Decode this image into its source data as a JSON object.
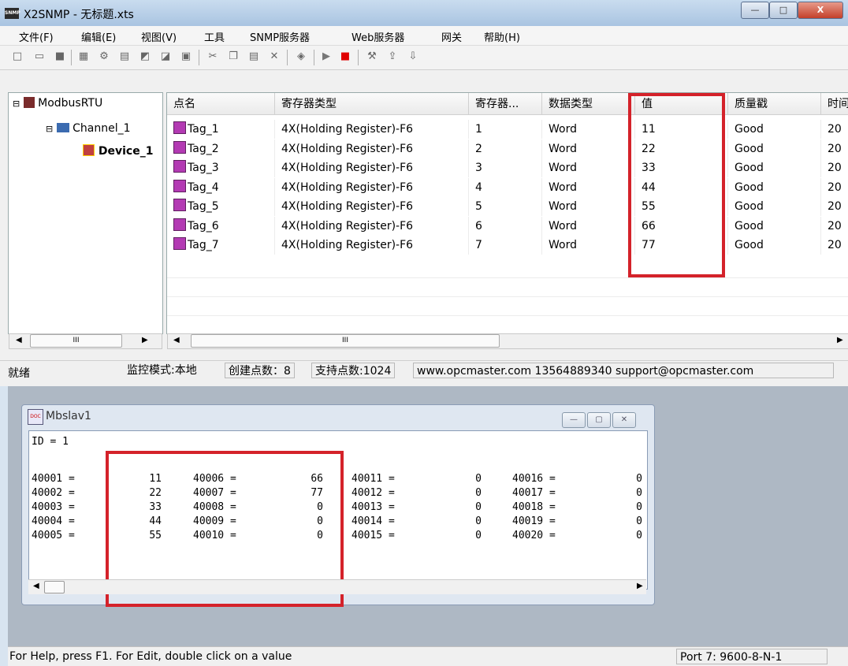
{
  "window": {
    "title": "X2SNMP - 无标题.xts",
    "app_icon": "SNMP",
    "min_glyph": "—",
    "max_glyph": "□",
    "close_glyph": "X"
  },
  "menu": [
    "文件(F)",
    "编辑(E)",
    "视图(V)",
    "工具",
    "SNMP服务器",
    "Web服务器",
    "网关",
    "帮助(H)"
  ],
  "tree": {
    "root": "ModbusRTU",
    "channel": "Channel_1",
    "device": "Device_1"
  },
  "grid": {
    "headers": [
      "点名",
      "寄存器类型",
      "寄存器...",
      "数据类型",
      "值",
      "质量戳",
      "时间"
    ],
    "rows": [
      {
        "name": "Tag_1",
        "reg_type": "4X(Holding Register)-F6",
        "addr": "1",
        "dtype": "Word",
        "value": "11",
        "quality": "Good",
        "time": "20"
      },
      {
        "name": "Tag_2",
        "reg_type": "4X(Holding Register)-F6",
        "addr": "2",
        "dtype": "Word",
        "value": "22",
        "quality": "Good",
        "time": "20"
      },
      {
        "name": "Tag_3",
        "reg_type": "4X(Holding Register)-F6",
        "addr": "3",
        "dtype": "Word",
        "value": "33",
        "quality": "Good",
        "time": "20"
      },
      {
        "name": "Tag_4",
        "reg_type": "4X(Holding Register)-F6",
        "addr": "4",
        "dtype": "Word",
        "value": "44",
        "quality": "Good",
        "time": "20"
      },
      {
        "name": "Tag_5",
        "reg_type": "4X(Holding Register)-F6",
        "addr": "5",
        "dtype": "Word",
        "value": "55",
        "quality": "Good",
        "time": "20"
      },
      {
        "name": "Tag_6",
        "reg_type": "4X(Holding Register)-F6",
        "addr": "6",
        "dtype": "Word",
        "value": "66",
        "quality": "Good",
        "time": "20"
      },
      {
        "name": "Tag_7",
        "reg_type": "4X(Holding Register)-F6",
        "addr": "7",
        "dtype": "Word",
        "value": "77",
        "quality": "Good",
        "time": "20"
      }
    ],
    "scroll_glyph": "III"
  },
  "status": {
    "ready": "就绪",
    "mode": "监控模式:本地",
    "created": "创建点数：8",
    "supported": "支持点数:1024",
    "contact": "www.opcmaster.com 13564889340 support@opcmaster.com"
  },
  "child": {
    "title": "Mbslav1",
    "icon_text": "DOC",
    "id_line": "ID = 1",
    "columns": [
      [
        {
          "reg": "40001 =",
          "val": "11"
        },
        {
          "reg": "40002 =",
          "val": "22"
        },
        {
          "reg": "40003 =",
          "val": "33"
        },
        {
          "reg": "40004 =",
          "val": "44"
        },
        {
          "reg": "40005 =",
          "val": "55"
        }
      ],
      [
        {
          "reg": "40006 =",
          "val": "66"
        },
        {
          "reg": "40007 =",
          "val": "77"
        },
        {
          "reg": "40008 =",
          "val": "0"
        },
        {
          "reg": "40009 =",
          "val": "0"
        },
        {
          "reg": "40010 =",
          "val": "0"
        }
      ],
      [
        {
          "reg": "40011 =",
          "val": "0"
        },
        {
          "reg": "40012 =",
          "val": "0"
        },
        {
          "reg": "40013 =",
          "val": "0"
        },
        {
          "reg": "40014 =",
          "val": "0"
        },
        {
          "reg": "40015 =",
          "val": "0"
        }
      ],
      [
        {
          "reg": "40016 =",
          "val": "0"
        },
        {
          "reg": "40017 =",
          "val": "0"
        },
        {
          "reg": "40018 =",
          "val": "0"
        },
        {
          "reg": "40019 =",
          "val": "0"
        },
        {
          "reg": "40020 =",
          "val": "0"
        }
      ]
    ]
  },
  "status2": {
    "help": "For Help, press F1.  For Edit, double click on a value",
    "port": "Port 7: 9600-8-N-1"
  },
  "colors": {
    "highlight": "#d4222a",
    "tag_icon": "#b33ab3"
  }
}
